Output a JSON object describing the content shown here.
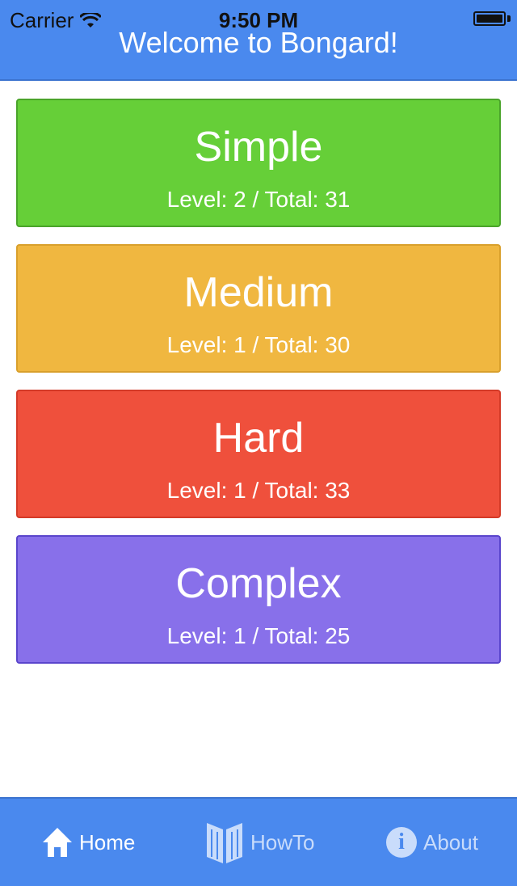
{
  "status_bar": {
    "carrier": "Carrier",
    "time": "9:50 PM",
    "icons": [
      "wifi-icon",
      "battery-icon"
    ]
  },
  "header": {
    "title": "Welcome to Bongard!",
    "background": "#4a89ee"
  },
  "levels": [
    {
      "name": "Simple",
      "stats": "Level: 2 / Total: 31",
      "color": "#66cf38"
    },
    {
      "name": "Medium",
      "stats": "Level: 1 / Total: 30",
      "color": "#f0b740"
    },
    {
      "name": "Hard",
      "stats": "Level: 1 / Total: 33",
      "color": "#ef503c"
    },
    {
      "name": "Complex",
      "stats": "Level: 1 / Total: 25",
      "color": "#8870ea"
    }
  ],
  "tabbar": {
    "tabs": [
      {
        "label": "Home",
        "icon": "home-icon",
        "selected": true
      },
      {
        "label": "HowTo",
        "icon": "book-icon",
        "selected": false
      },
      {
        "label": "About",
        "icon": "info-icon",
        "selected": false
      }
    ]
  }
}
